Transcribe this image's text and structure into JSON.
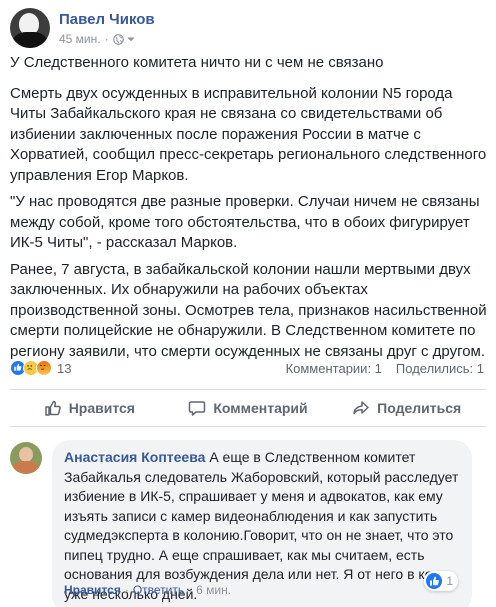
{
  "post": {
    "author": "Павел Чиков",
    "time": "45 мин.",
    "dot": "·",
    "headline": "У Следственного комитета ничто ни с чем не связано",
    "paragraphs": [
      "Смерть двух осужденных в исправительной колонии N5 города Читы Забайкальского края не связана со свидетельствами об избиении заключенных после поражения России в матче с Хорватией, сообщил пресс-секретарь регионального следственного управления Егор Марков.",
      "\"У нас проводятся две разные проверки. Случаи ничем не связаны между собой, кроме того обстоятельства, что в обоих фигурирует ИК-5 Читы\", - рассказал Марков.",
      "Ранее, 7 августа, в забайкальской колонии нашли мертвыми двух заключенных. Их обнаружили на рабочих объектах производственной зоны. Осмотрев тела, признаков насильственной смерти полицейские не обнаружили. В Следственном комитете по региону заявили, что смерти осужденных не связаны друг с другом."
    ]
  },
  "reactions": {
    "count": "13",
    "comments": "Комментарии: 1",
    "shares": "Поделились: 1",
    "icons": [
      "like-icon",
      "sad-icon",
      "angry-icon"
    ],
    "colors": {
      "like": "#2078f4",
      "sad": "#f7c847",
      "angry": "#e9710f"
    }
  },
  "actions": {
    "like": "Нравится",
    "comment": "Комментарий",
    "share": "Поделиться"
  },
  "comment": {
    "author": "Анастасия Коптеева",
    "text": "А еще в Следственном комитет Забайкалья следователь Жаборовский, который расследует избиение в ИК-5, спрашивает у меня и адвокатов, как ему изъять записи с камер видеонаблюдения и как запустить судмедэксперта в колонию.Говорит, что он не знает, что это пипец трудно. А еще спрашивает, как мы считаем, есть основания для возбуждения дела или нет. Я от него в коме уже несколько дней.",
    "like_label": "Нравится",
    "reply_label": "Ответить",
    "sep": "·",
    "time": "6 мин.",
    "like_count": "1"
  },
  "theme": {
    "link": "#385898",
    "muted": "#90949c",
    "text": "#1d2129"
  }
}
